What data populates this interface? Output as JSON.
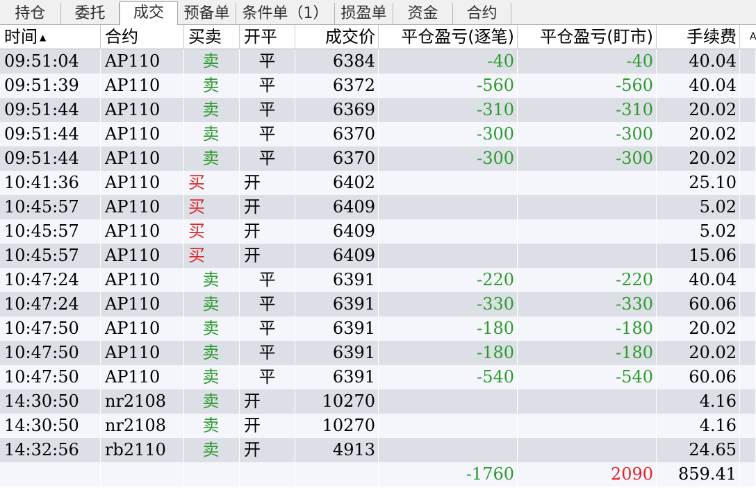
{
  "colors": {
    "buy": "#e0252a",
    "sell": "#2e9a2e",
    "loss": "#2e9a2e",
    "profit": "#e0252a"
  },
  "tabs": [
    {
      "label": "持仓",
      "active": false
    },
    {
      "label": "委托",
      "active": false
    },
    {
      "label": "成交",
      "active": true
    },
    {
      "label": "预备单",
      "active": false
    },
    {
      "label": "条件单（1）",
      "active": false
    },
    {
      "label": "损盈单",
      "active": false
    },
    {
      "label": "资金",
      "active": false
    },
    {
      "label": "合约",
      "active": false
    }
  ],
  "columns": {
    "time": "时间",
    "contract": "合约",
    "side": "买卖",
    "open_close": "开平",
    "price": "成交价",
    "pnl_trade": "平仓盈亏(逐笔)",
    "pnl_mark": "平仓盈亏(盯市)",
    "fee": "手续费",
    "extra": "A"
  },
  "rows": [
    {
      "time": "09:51:04",
      "contract": "AP110",
      "side": "卖",
      "open_close": "平",
      "price": "6384",
      "pnl_trade": "-40",
      "pnl_mark": "-40",
      "fee": "40.04"
    },
    {
      "time": "09:51:39",
      "contract": "AP110",
      "side": "卖",
      "open_close": "平",
      "price": "6372",
      "pnl_trade": "-560",
      "pnl_mark": "-560",
      "fee": "40.04"
    },
    {
      "time": "09:51:44",
      "contract": "AP110",
      "side": "卖",
      "open_close": "平",
      "price": "6369",
      "pnl_trade": "-310",
      "pnl_mark": "-310",
      "fee": "20.02"
    },
    {
      "time": "09:51:44",
      "contract": "AP110",
      "side": "卖",
      "open_close": "平",
      "price": "6370",
      "pnl_trade": "-300",
      "pnl_mark": "-300",
      "fee": "20.02"
    },
    {
      "time": "09:51:44",
      "contract": "AP110",
      "side": "卖",
      "open_close": "平",
      "price": "6370",
      "pnl_trade": "-300",
      "pnl_mark": "-300",
      "fee": "20.02"
    },
    {
      "time": "10:41:36",
      "contract": "AP110",
      "side": "买",
      "open_close": "开",
      "price": "6402",
      "pnl_trade": "",
      "pnl_mark": "",
      "fee": "25.10"
    },
    {
      "time": "10:45:57",
      "contract": "AP110",
      "side": "买",
      "open_close": "开",
      "price": "6409",
      "pnl_trade": "",
      "pnl_mark": "",
      "fee": "5.02"
    },
    {
      "time": "10:45:57",
      "contract": "AP110",
      "side": "买",
      "open_close": "开",
      "price": "6409",
      "pnl_trade": "",
      "pnl_mark": "",
      "fee": "5.02"
    },
    {
      "time": "10:45:57",
      "contract": "AP110",
      "side": "买",
      "open_close": "开",
      "price": "6409",
      "pnl_trade": "",
      "pnl_mark": "",
      "fee": "15.06"
    },
    {
      "time": "10:47:24",
      "contract": "AP110",
      "side": "卖",
      "open_close": "平",
      "price": "6391",
      "pnl_trade": "-220",
      "pnl_mark": "-220",
      "fee": "40.04"
    },
    {
      "time": "10:47:24",
      "contract": "AP110",
      "side": "卖",
      "open_close": "平",
      "price": "6391",
      "pnl_trade": "-330",
      "pnl_mark": "-330",
      "fee": "60.06"
    },
    {
      "time": "10:47:50",
      "contract": "AP110",
      "side": "卖",
      "open_close": "平",
      "price": "6391",
      "pnl_trade": "-180",
      "pnl_mark": "-180",
      "fee": "20.02"
    },
    {
      "time": "10:47:50",
      "contract": "AP110",
      "side": "卖",
      "open_close": "平",
      "price": "6391",
      "pnl_trade": "-180",
      "pnl_mark": "-180",
      "fee": "20.02"
    },
    {
      "time": "10:47:50",
      "contract": "AP110",
      "side": "卖",
      "open_close": "平",
      "price": "6391",
      "pnl_trade": "-540",
      "pnl_mark": "-540",
      "fee": "60.06"
    },
    {
      "time": "14:30:50",
      "contract": "nr2108",
      "side": "卖",
      "open_close": "开",
      "price": "10270",
      "pnl_trade": "",
      "pnl_mark": "",
      "fee": "4.16"
    },
    {
      "time": "14:30:50",
      "contract": "nr2108",
      "side": "卖",
      "open_close": "开",
      "price": "10270",
      "pnl_trade": "",
      "pnl_mark": "",
      "fee": "4.16"
    },
    {
      "time": "14:32:56",
      "contract": "rb2110",
      "side": "卖",
      "open_close": "开",
      "price": "4913",
      "pnl_trade": "",
      "pnl_mark": "",
      "fee": "24.65"
    }
  ],
  "totals": {
    "pnl_trade": "-1760",
    "pnl_mark": "2090",
    "fee": "859.41"
  }
}
